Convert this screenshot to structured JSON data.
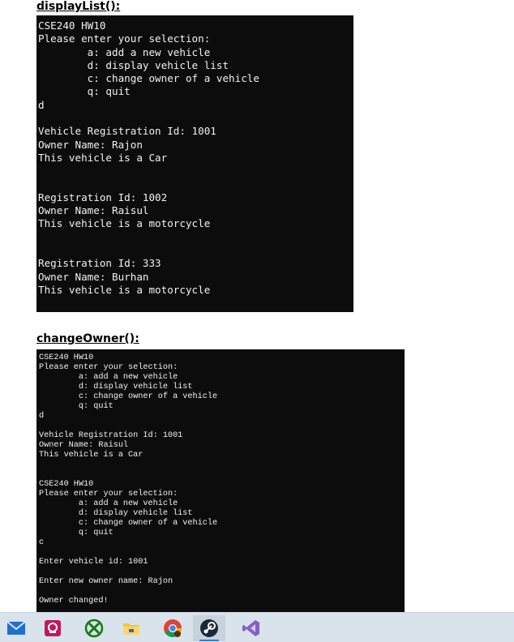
{
  "sections": {
    "display_list": {
      "heading": "displayList():"
    },
    "change_owner": {
      "heading": "changeOwner():"
    }
  },
  "console1": {
    "lines": [
      "CSE240 HW10",
      "Please enter your selection:",
      "        a: add a new vehicle",
      "        d: display vehicle list",
      "        c: change owner of a vehicle",
      "        q: quit",
      "d",
      "",
      "Vehicle Registration Id: 1001",
      "Owner Name: Rajon",
      "This vehicle is a Car",
      "",
      "",
      "Registration Id: 1002",
      "Owner Name: Raisul",
      "This vehicle is a motorcycle",
      "",
      "",
      "Registration Id: 333",
      "Owner Name: Burhan",
      "This vehicle is a motorcycle"
    ]
  },
  "console2": {
    "lines": [
      "CSE240 HW10",
      "Please enter your selection:",
      "        a: add a new vehicle",
      "        d: display vehicle list",
      "        c: change owner of a vehicle",
      "        q: quit",
      "d",
      "",
      "Vehicle Registration Id: 1001",
      "Owner Name: Raisul",
      "This vehicle is a Car",
      "",
      "",
      "CSE240 HW10",
      "Please enter your selection:",
      "        a: add a new vehicle",
      "        d: display vehicle list",
      "        c: change owner of a vehicle",
      "        q: quit",
      "c",
      "",
      "Enter vehicle id: 1001",
      "",
      "Enter new owner name: Rajon",
      "",
      "Owner changed!"
    ]
  },
  "taskbar": {
    "icons": [
      "mail-icon",
      "privacy-app-icon",
      "xbox-icon",
      "file-explorer-icon",
      "chrome-icon",
      "steam-icon",
      "visual-studio-icon"
    ]
  }
}
